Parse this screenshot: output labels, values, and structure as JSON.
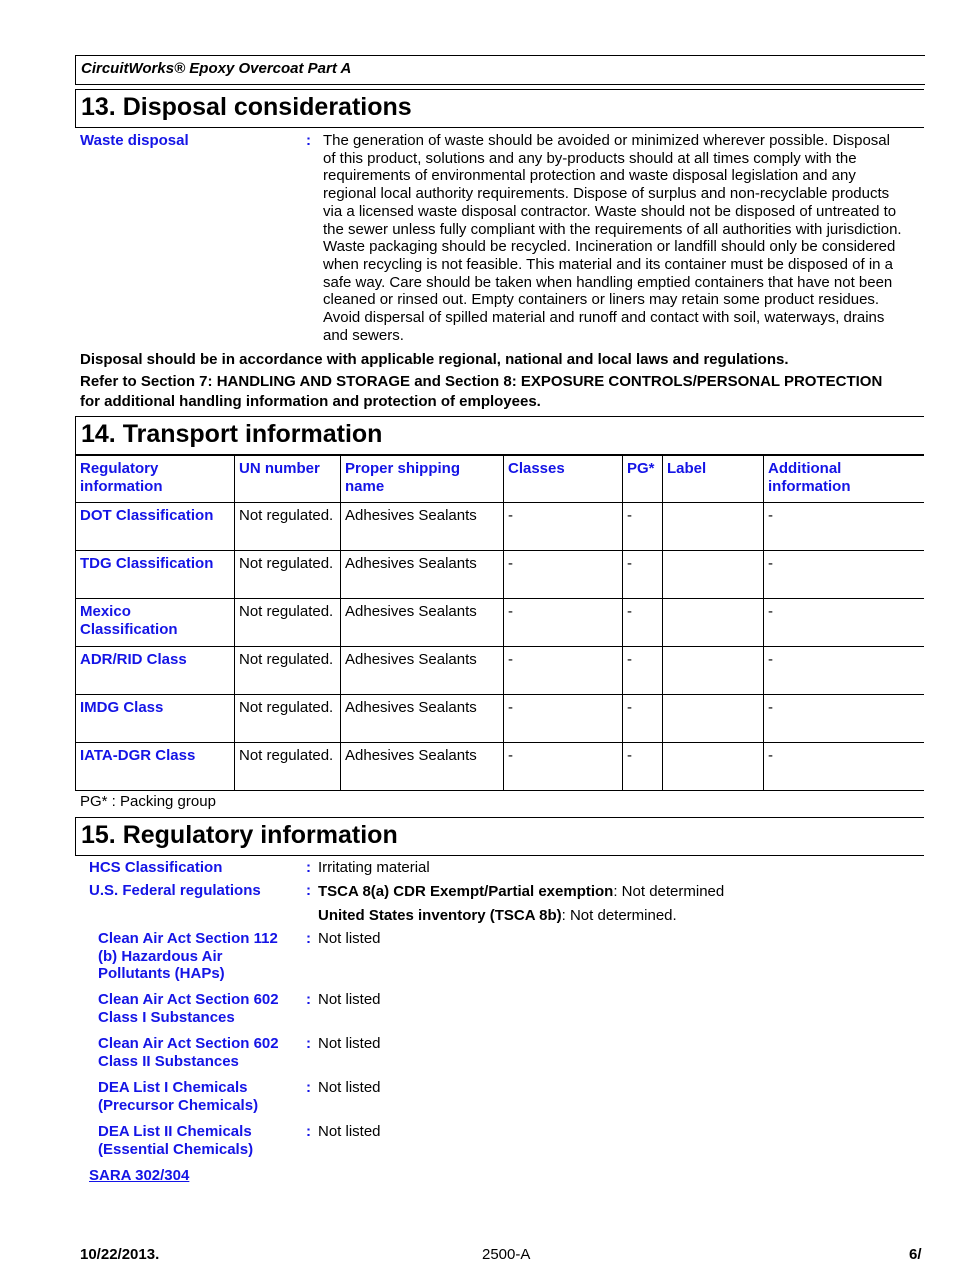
{
  "product_name": "CircuitWorks® Epoxy Overcoat Part A",
  "section13": {
    "title": "13. Disposal considerations",
    "waste_disposal_label": "Waste disposal",
    "waste_disposal_lines": [
      "The generation of waste should be avoided or minimized wherever possible.  Disposal",
      "of this product, solutions and any by-products should at all times comply with the",
      "requirements of environmental protection and waste disposal legislation and any",
      "regional local authority requirements.  Dispose of surplus and non-recyclable products",
      "via a licensed waste disposal contractor.  Waste should not be disposed of untreated to",
      "the sewer unless fully compliant with the requirements of all authorities with jurisdiction.",
      "Waste packaging should be recycled.  Incineration or landfill should only be considered",
      "when recycling is not feasible.  This material and its container must be disposed of in a",
      "safe way.  Care should be taken when handling emptied containers that have not been",
      "cleaned or rinsed out.  Empty containers or liners may retain some product residues.",
      "Avoid dispersal of spilled material and runoff and contact with soil, waterways, drains",
      "and sewers."
    ],
    "note1": "Disposal should be in accordance with applicable regional, national and local laws and regulations.",
    "note2_line1": "Refer to Section 7: HANDLING AND STORAGE and Section 8: EXPOSURE CONTROLS/PERSONAL PROTECTION",
    "note2_line2": "for additional handling information and protection of employees."
  },
  "section14": {
    "title": "14. Transport information",
    "headers": [
      "Regulatory information",
      "UN number",
      "Proper shipping name",
      "Classes",
      "PG*",
      "Label",
      "Additional information"
    ],
    "rows": [
      {
        "label": "DOT Classification",
        "un": "Not regulated.",
        "name": "Adhesives Sealants",
        "classes": "-",
        "pg": "-",
        "lbl": "",
        "additional": "-"
      },
      {
        "label": "TDG Classification",
        "un": "Not regulated.",
        "name": "Adhesives Sealants",
        "classes": "-",
        "pg": "-",
        "lbl": "",
        "additional": "-"
      },
      {
        "label": "Mexico Classification",
        "un": "Not regulated.",
        "name": "Adhesives Sealants",
        "classes": "-",
        "pg": "-",
        "lbl": "",
        "additional": "-"
      },
      {
        "label": "ADR/RID Class",
        "un": "Not regulated.",
        "name": "Adhesives Sealants",
        "classes": "-",
        "pg": "-",
        "lbl": "",
        "additional": "-"
      },
      {
        "label": "IMDG Class",
        "un": "Not regulated.",
        "name": "Adhesives Sealants",
        "classes": "-",
        "pg": "-",
        "lbl": "",
        "additional": "-"
      },
      {
        "label": "IATA-DGR Class",
        "un": "Not regulated.",
        "name": "Adhesives Sealants",
        "classes": "-",
        "pg": "-",
        "lbl": "",
        "additional": "-"
      }
    ],
    "pg_note": "PG* : Packing group"
  },
  "section15": {
    "title": "15. Regulatory information",
    "hcs_label": "HCS Classification",
    "hcs_value": "Irritating material",
    "federal_label": "U.S. Federal regulations",
    "tsca8a_bold": "TSCA 8(a) CDR Exempt/Partial exemption",
    "tsca8a_value": ": Not determined",
    "tsca8b_bold": "United States inventory (TSCA 8b)",
    "tsca8b_value": ": Not determined.",
    "items": [
      {
        "label_lines": [
          "Clean Air Act  Section 112",
          "(b) Hazardous Air",
          "Pollutants (HAPs)"
        ],
        "value": "Not listed"
      },
      {
        "label_lines": [
          "Clean Air Act Section 602",
          "Class I Substances"
        ],
        "value": "Not listed"
      },
      {
        "label_lines": [
          "Clean Air Act Section 602",
          "Class II Substances"
        ],
        "value": "Not listed"
      },
      {
        "label_lines": [
          "DEA List I Chemicals",
          "(Precursor Chemicals)"
        ],
        "value": "Not listed"
      },
      {
        "label_lines": [
          "DEA List II Chemicals",
          "(Essential Chemicals)"
        ],
        "value": "Not listed"
      }
    ],
    "sara_label": "SARA 302/304"
  },
  "footer": {
    "date": "10/22/2013.",
    "code": "2500-A",
    "page": "6/"
  }
}
